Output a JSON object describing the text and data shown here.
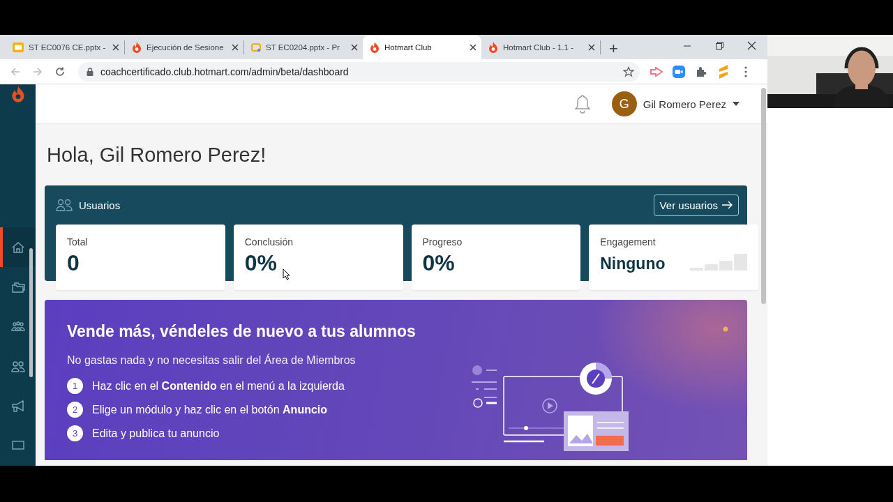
{
  "browser": {
    "tabs": [
      {
        "title": "ST EC0076 CE.pptx -",
        "kind": "slides",
        "selected": false
      },
      {
        "title": "Ejecución de Sesione",
        "kind": "flame",
        "selected": false
      },
      {
        "title": "ST EC0204.pptx - Pr",
        "kind": "slides-alt",
        "selected": false
      },
      {
        "title": "Hotmart Club",
        "kind": "flame",
        "selected": true
      },
      {
        "title": "Hotmart Club - 1.1 -",
        "kind": "flame",
        "selected": false
      }
    ],
    "new_tab": "+",
    "address": "coachcertificado.club.hotmart.com/admin/beta/dashboard"
  },
  "header": {
    "avatar_letter": "G",
    "user_name": "Gil Romero Perez"
  },
  "sidebar": {
    "items": [
      {
        "kind": "home",
        "selected": true
      },
      {
        "kind": "folders",
        "selected": false
      },
      {
        "kind": "group",
        "selected": false
      },
      {
        "kind": "users",
        "selected": false
      },
      {
        "kind": "megaphone",
        "selected": false
      },
      {
        "kind": "monitor",
        "selected": false
      }
    ]
  },
  "greeting": "Hola, Gil Romero Perez!",
  "users_panel": {
    "title": "Usuarios",
    "button": "Ver usuarios",
    "stats": [
      {
        "kind": "number",
        "label": "Total",
        "value": "0"
      },
      {
        "kind": "number",
        "label": "Conclusión",
        "value": "0%"
      },
      {
        "kind": "number",
        "label": "Progreso",
        "value": "0%"
      },
      {
        "kind": "meter",
        "label": "Engagement",
        "value": "Ninguno",
        "level": 0
      }
    ]
  },
  "promo": {
    "title": "Vende más, véndeles de nuevo a tus alumnos",
    "subtitle": "No gastas nada y no necesitas salir del Área de Miembros",
    "steps": [
      {
        "number": "1",
        "text": "Haz clic en el **Contenido** en el menú a la izquierda"
      },
      {
        "number": "2",
        "text": "Elige un módulo y haz clic en el botón **Anuncio**"
      },
      {
        "number": "3",
        "text": "Edita y publica tu anuncio"
      }
    ]
  }
}
